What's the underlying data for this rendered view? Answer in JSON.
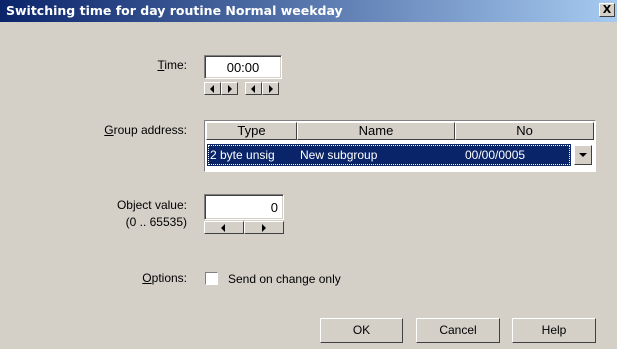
{
  "window": {
    "title": "Switching time for day routine Normal weekday",
    "close_glyph": "X"
  },
  "time": {
    "label_mnemonic": "T",
    "label_rest": "ime:",
    "value": "00:00"
  },
  "group_address": {
    "label_mnemonic": "G",
    "label_rest": "roup address:",
    "columns": [
      "Type",
      "Name",
      "No"
    ],
    "selected_row": {
      "type": "2 byte unsig",
      "name": "New subgroup",
      "no": "00/00/0005"
    }
  },
  "object_value": {
    "label": "Object value:",
    "range": "(0 .. 65535)",
    "value": "0"
  },
  "options": {
    "label_mnemonic": "O",
    "label_rest": "ptions:",
    "checkbox_label": "Send on change only",
    "checked": false
  },
  "buttons": {
    "ok": "OK",
    "cancel": "Cancel",
    "help": "Help"
  }
}
